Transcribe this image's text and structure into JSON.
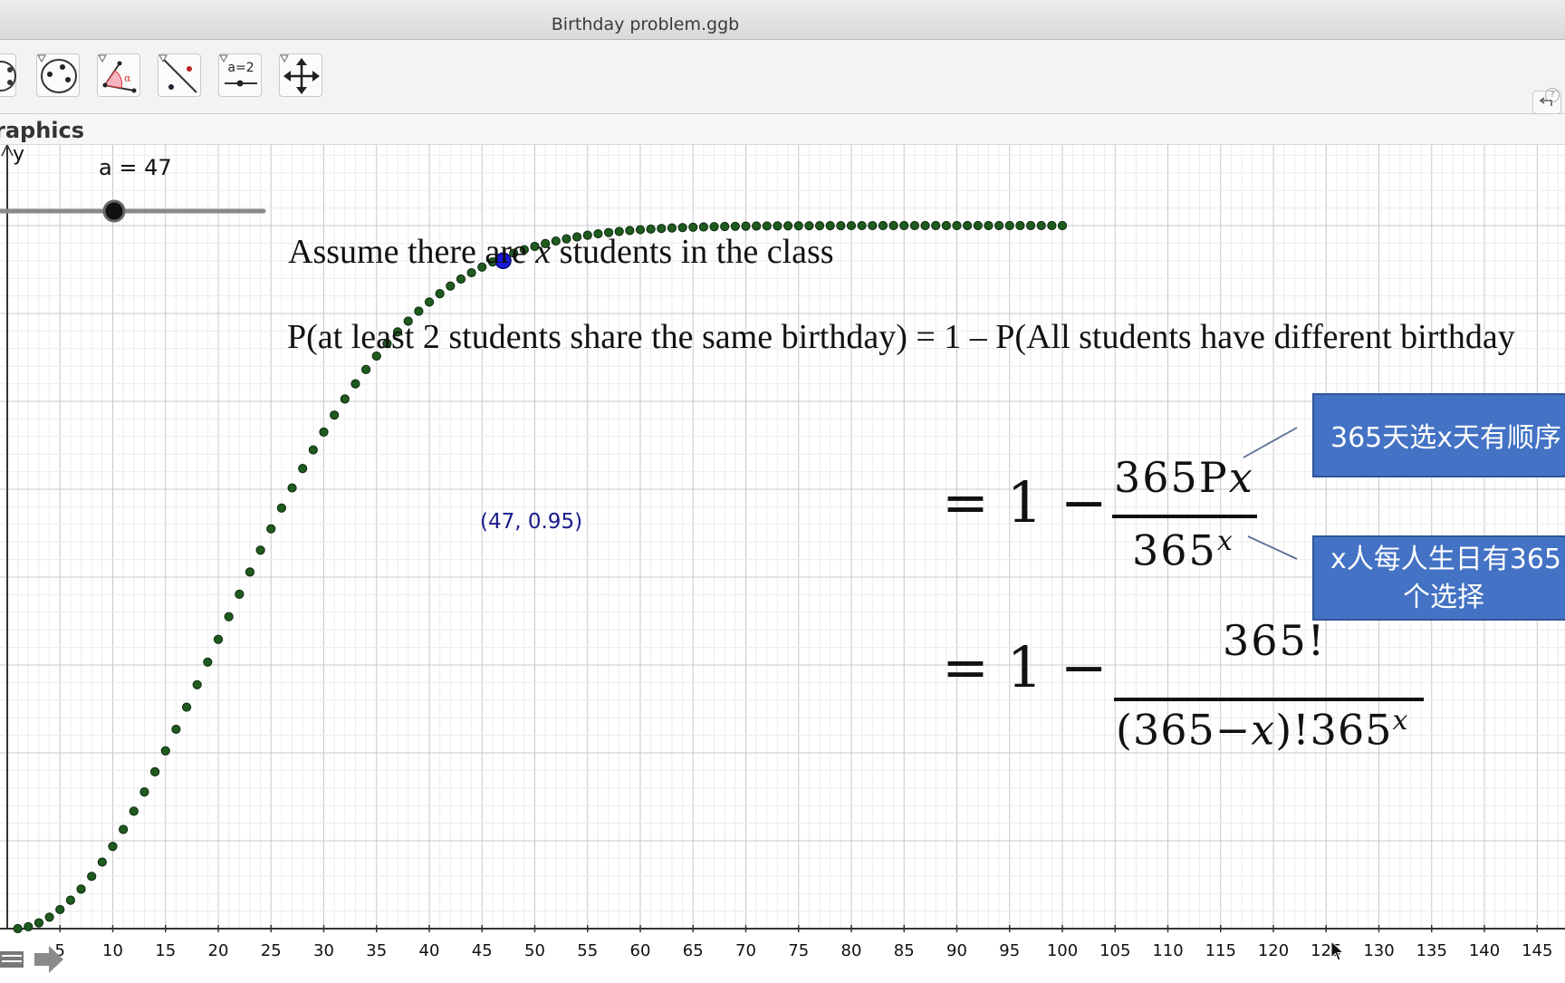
{
  "window": {
    "title": "Birthday problem.ggb"
  },
  "toolbar": {
    "tools": [
      {
        "name": "circle-tool-icon"
      },
      {
        "name": "conic-tool-icon"
      },
      {
        "name": "angle-tool-icon"
      },
      {
        "name": "reflect-tool-icon"
      },
      {
        "name": "slider-tool-icon",
        "label": "a=2"
      },
      {
        "name": "move-graphics-tool-icon"
      }
    ]
  },
  "view": {
    "label": "raphics"
  },
  "axes": {
    "y_label": "y",
    "x_ticks": [
      "5",
      "10",
      "15",
      "20",
      "25",
      "30",
      "35",
      "40",
      "45",
      "50",
      "55",
      "60",
      "65",
      "70",
      "75",
      "80",
      "85",
      "90",
      "95",
      "100",
      "105",
      "110",
      "115",
      "120",
      "125",
      "130",
      "135",
      "140",
      "145"
    ]
  },
  "slider": {
    "label": "a = 47",
    "value": 47
  },
  "text": {
    "line1_pre": "Assume there are ",
    "line1_var": "x",
    "line1_post": " students in the class",
    "line2": "P(at least 2 students share the same birthday) = 1 – P(All students have different birthday"
  },
  "formula1": {
    "eq": "= 1 −",
    "num": "365P",
    "num_var": "x",
    "den": "365",
    "den_exp": "x"
  },
  "formula2": {
    "eq": "= 1 −",
    "num": "365!",
    "den_pre": "(365−",
    "den_var": "x",
    "den_mid": ")!365",
    "den_exp": "x"
  },
  "callouts": {
    "first": "365天选x天有顺序",
    "second_line1": "x人每人生日有365",
    "second_line2": "个选择"
  },
  "point": {
    "label": "(47, 0.95)",
    "x": 47,
    "y": 0.95
  },
  "colors": {
    "dots": "#1f5a1f",
    "point": "#1a1adf",
    "point_label": "#1a1a8c",
    "callout": "#4472c4"
  },
  "chart_data": {
    "type": "scatter",
    "description_x_range": [
      1,
      100
    ],
    "series": [
      {
        "function": "1 - 365!/((365-x)! * 365^x)",
        "x_from": 1,
        "x_to": 100,
        "x_step": 1
      }
    ],
    "highlight": {
      "x": 47,
      "y": 0.95
    },
    "xlim": [
      0,
      148
    ],
    "ylim": [
      0,
      1.07
    ]
  }
}
